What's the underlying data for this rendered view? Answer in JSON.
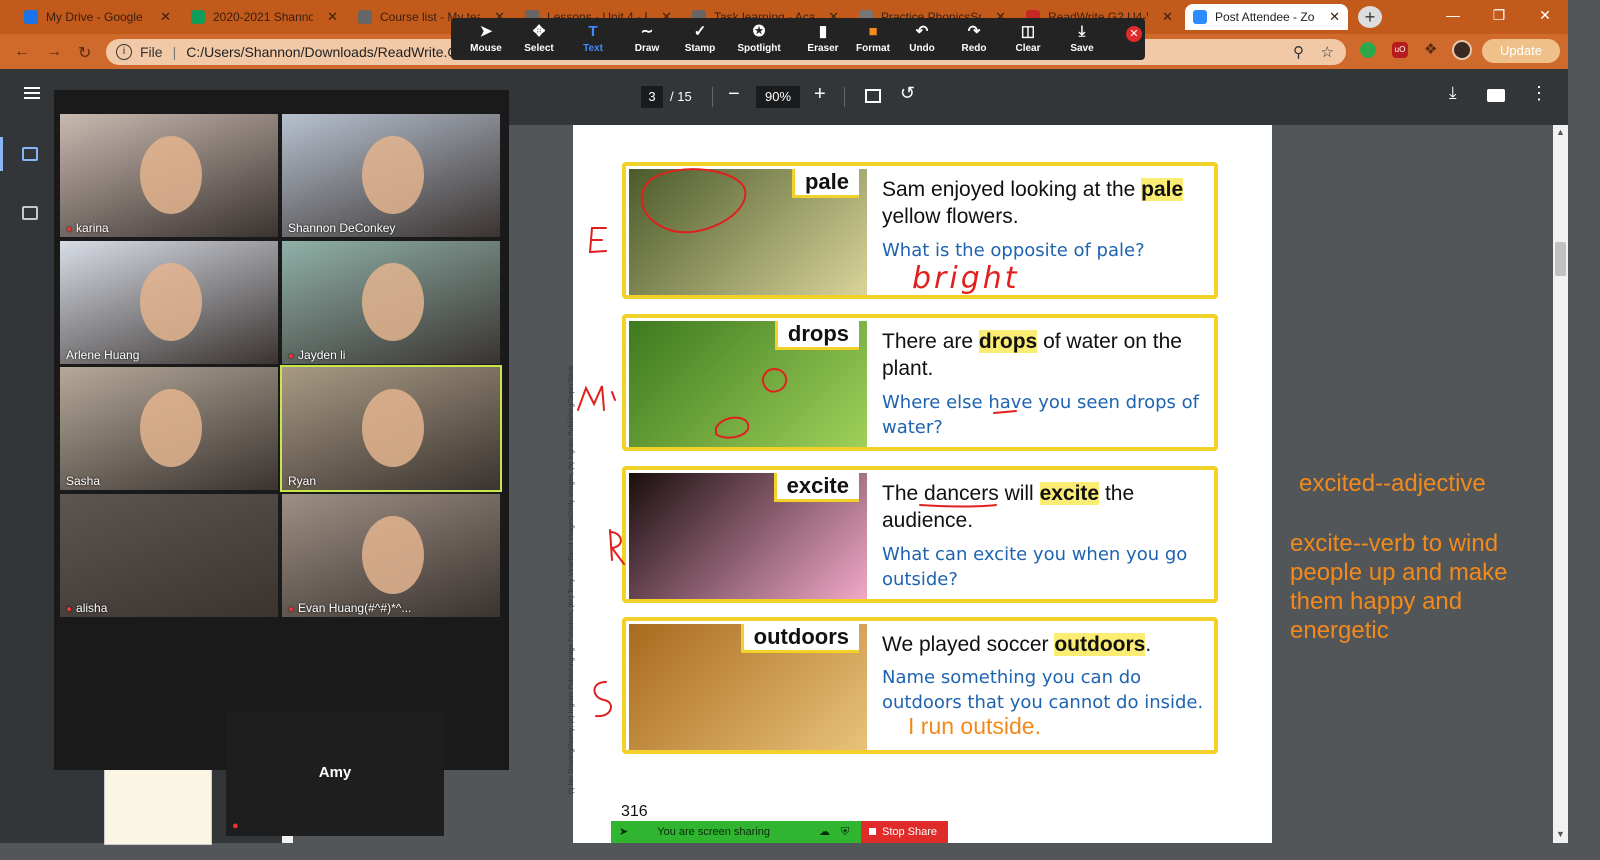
{
  "browser": {
    "tabs": [
      {
        "title": "My Drive - Google D",
        "favicon": "#1a73e8"
      },
      {
        "title": "2020-2021 Shannon",
        "favicon": "#0f9d58"
      },
      {
        "title": "Course list - My tea",
        "favicon": "#666666"
      },
      {
        "title": "Lessons - Unit 4 - R",
        "favicon": "#666666"
      },
      {
        "title": "Task learning - Acad",
        "favicon": "#666666"
      },
      {
        "title": "Practice PhonicsSpe",
        "favicon": "#777777"
      },
      {
        "title": "ReadWrite.G2.U4-W",
        "favicon": "#c62828"
      },
      {
        "title": "Post Attendee - Zoo",
        "favicon": "#2d8cff"
      }
    ],
    "url_label": "File",
    "url": "C:/Users/Shannon/Downloads/ReadWrite.G2.",
    "update_label": "Update"
  },
  "annotate_toolbar": {
    "tools": [
      {
        "label": "Mouse",
        "icon": "mouse-pointer-icon"
      },
      {
        "label": "Select",
        "icon": "move-icon"
      },
      {
        "label": "Text",
        "icon": "text-icon"
      },
      {
        "label": "Draw",
        "icon": "draw-icon"
      },
      {
        "label": "Stamp",
        "icon": "stamp-icon"
      },
      {
        "label": "Spotlight",
        "icon": "spotlight-icon"
      },
      {
        "label": "Eraser",
        "icon": "eraser-icon"
      },
      {
        "label": "Format",
        "icon": "format-icon"
      },
      {
        "label": "Undo",
        "icon": "undo-icon"
      },
      {
        "label": "Redo",
        "icon": "redo-icon"
      },
      {
        "label": "Clear",
        "icon": "trash-icon"
      },
      {
        "label": "Save",
        "icon": "save-icon"
      }
    ],
    "active_tool": "Text"
  },
  "pdf_toolbar": {
    "current_page": "3",
    "total_pages": "/ 15",
    "zoom": "90%"
  },
  "gallery": {
    "participants": [
      {
        "name": "karina",
        "muted": true,
        "bg": "#c9b9b0"
      },
      {
        "name": "Shannon DeConkey",
        "muted": false,
        "bg": "#b7c1cf"
      },
      {
        "name": "Arlene Huang",
        "muted": false,
        "bg": "#d8dde6"
      },
      {
        "name": "Jayden li",
        "muted": true,
        "bg": "#8fb1a8"
      },
      {
        "name": "Sasha",
        "muted": false,
        "bg": "#b5a999"
      },
      {
        "name": "Ryan",
        "muted": false,
        "bg": "#a89a83"
      },
      {
        "name": "alisha",
        "muted": true,
        "bg": "#5c5651"
      },
      {
        "name": "Evan Huang(#^#)*^...",
        "muted": true,
        "bg": "#9d8f84"
      }
    ],
    "amy_name": "Amy"
  },
  "page": {
    "cards": [
      {
        "word": "pale",
        "sentence_before": "Sam enjoyed looking at the ",
        "sentence_highlight": "pale",
        "sentence_after": " yellow flowers.",
        "question": "What is the opposite of pale?",
        "photo_colors": [
          "#4a5a2a",
          "#d9d49a"
        ]
      },
      {
        "word": "drops",
        "sentence_before": "There are ",
        "sentence_highlight": "drops",
        "sentence_after": " of water on the plant.",
        "question": "Where else have you seen drops of water?",
        "photo_colors": [
          "#3d7a1e",
          "#9fd05a"
        ]
      },
      {
        "word": "excite",
        "sentence_before": "The dancers will ",
        "sentence_highlight": "excite",
        "sentence_after": " the audience.",
        "question": "What can excite you when you go outside?",
        "photo_colors": [
          "#1a0e0e",
          "#f2a8c8"
        ]
      },
      {
        "word": "outdoors",
        "sentence_before": "We played soccer ",
        "sentence_highlight": "outdoors",
        "sentence_after": ".",
        "question": "Name something you can do outdoors that you cannot do inside.",
        "photo_colors": [
          "#a86a1e",
          "#e9c27a"
        ]
      }
    ],
    "photo_credit": "(t) Ian Dowling/Alamy; (c) Ingram Publishing/age Fotostock; (bc) Terry Vine/Blend Images/Getty Images; (b) Ingram Publishing/SuperStock",
    "page_number": "316",
    "handwritten_answer": "bright",
    "typed_answer": "I run outside."
  },
  "notes": {
    "line1": "excited--adjective",
    "line2": "excite--verb to wind people up and make them happy and energetic"
  },
  "share_bar": {
    "status": "You are screen sharing",
    "stop_label": "Stop Share"
  },
  "colors": {
    "tabstrip": "#c25a1c",
    "accent_yellow": "#f2d22a",
    "question_blue": "#1e63b0",
    "note_orange": "#f18a1c",
    "ink_red": "#e0201e"
  }
}
